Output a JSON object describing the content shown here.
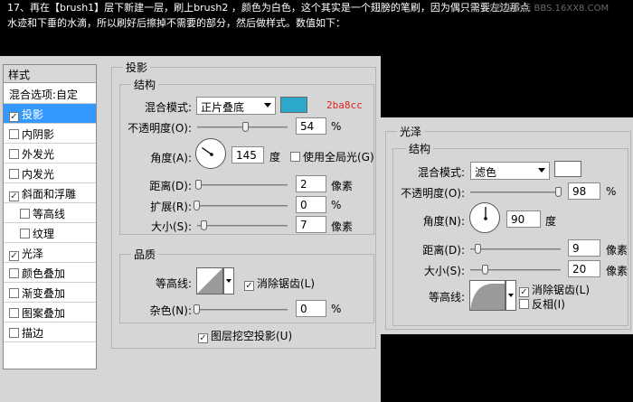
{
  "caption": {
    "line1": "17、再在【brush1】层下新建一层，刷上brush2 ，颜色为白色，这个其实是一个翅膀的笔刷，因为偶只需要左边那点",
    "watermark": "PS教程论坛 BBS.16XX8.COM",
    "line2": "水迹和下垂的水滴，所以刷好后擦掉不需要的部分，然后做样式。数值如下："
  },
  "styles_panel": {
    "title": "样式",
    "items": [
      {
        "label": "混合选项:自定",
        "checkbox": false,
        "checked": false,
        "selected": false,
        "indent": false
      },
      {
        "label": "投影",
        "checkbox": true,
        "checked": true,
        "selected": true,
        "indent": false
      },
      {
        "label": "内阴影",
        "checkbox": true,
        "checked": false,
        "selected": false,
        "indent": false
      },
      {
        "label": "外发光",
        "checkbox": true,
        "checked": false,
        "selected": false,
        "indent": false
      },
      {
        "label": "内发光",
        "checkbox": true,
        "checked": false,
        "selected": false,
        "indent": false
      },
      {
        "label": "斜面和浮雕",
        "checkbox": true,
        "checked": true,
        "selected": false,
        "indent": false
      },
      {
        "label": "等高线",
        "checkbox": true,
        "checked": false,
        "selected": false,
        "indent": true
      },
      {
        "label": "纹理",
        "checkbox": true,
        "checked": false,
        "selected": false,
        "indent": true
      },
      {
        "label": "光泽",
        "checkbox": true,
        "checked": true,
        "selected": false,
        "indent": false
      },
      {
        "label": "颜色叠加",
        "checkbox": true,
        "checked": false,
        "selected": false,
        "indent": false
      },
      {
        "label": "渐变叠加",
        "checkbox": true,
        "checked": false,
        "selected": false,
        "indent": false
      },
      {
        "label": "图案叠加",
        "checkbox": true,
        "checked": false,
        "selected": false,
        "indent": false
      },
      {
        "label": "描边",
        "checkbox": true,
        "checked": false,
        "selected": false,
        "indent": false
      }
    ]
  },
  "drop_shadow": {
    "title": "投影",
    "structure_title": "结构",
    "blend_mode_label": "混合模式:",
    "blend_mode_value": "正片叠底",
    "color_hex": "#2ba8cc",
    "color_note": "2ba8cc",
    "opacity_label": "不透明度(O):",
    "opacity_value": "54",
    "opacity_fraction": 0.54,
    "opacity_unit": "%",
    "angle_label": "角度(A):",
    "angle_value": "145",
    "angle_unit": "度",
    "global_light_label": "使用全局光(G)",
    "global_light_checked": false,
    "distance_label": "距离(D):",
    "distance_value": "2",
    "distance_unit": "像素",
    "spread_label": "扩展(R):",
    "spread_value": "0",
    "spread_unit": "%",
    "size_label": "大小(S):",
    "size_value": "7",
    "size_unit": "像素",
    "quality_title": "品质",
    "contour_label": "等高线:",
    "antialias_label": "消除锯齿(L)",
    "antialias_checked": true,
    "noise_label": "杂色(N):",
    "noise_value": "0",
    "noise_unit": "%",
    "knockout_label": "图层挖空投影(U)",
    "knockout_checked": true
  },
  "satin": {
    "title": "光泽",
    "structure_title": "结构",
    "blend_mode_label": "混合模式:",
    "blend_mode_value": "滤色",
    "color_hex": "#ffffff",
    "opacity_label": "不透明度(O):",
    "opacity_value": "98",
    "opacity_fraction": 0.98,
    "opacity_unit": "%",
    "angle_label": "角度(N):",
    "angle_value": "90",
    "angle_unit": "度",
    "distance_label": "距离(D):",
    "distance_value": "9",
    "distance_unit": "像素",
    "size_label": "大小(S):",
    "size_value": "20",
    "size_unit": "像素",
    "contour_label": "等高线:",
    "antialias_label": "消除锯齿(L)",
    "antialias_checked": true,
    "invert_label": "反相(I)",
    "invert_checked": false
  }
}
